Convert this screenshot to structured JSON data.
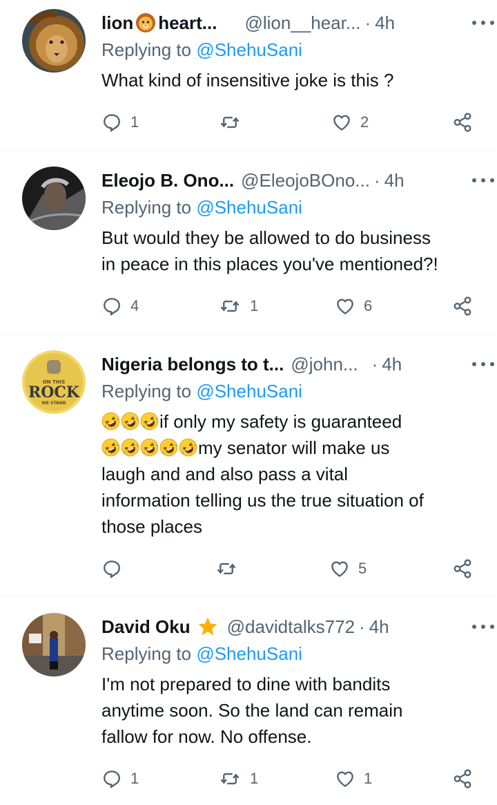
{
  "replying_label": "Replying to",
  "replies": [
    {
      "name": "lion",
      "name_suffix": "heart...",
      "name_emoji": "lion-face",
      "handle": "@lion__hear...",
      "dot": "·",
      "time": "4h",
      "replying_to": "@ShehuSani",
      "lines": [
        "What kind of insensitive joke is this ?"
      ],
      "counts": {
        "reply": "1",
        "retweet": "",
        "like": "2"
      }
    },
    {
      "name": "Eleojo B. Ono...",
      "handle": "@EleojoBOno...",
      "dot": "·",
      "time": "4h",
      "replying_to": "@ShehuSani",
      "lines": [
        "But would they be allowed to do business",
        "in peace in this places you've mentioned?!"
      ],
      "counts": {
        "reply": "4",
        "retweet": "1",
        "like": "6"
      }
    },
    {
      "name": "Nigeria belongs to t...",
      "handle": "@john...",
      "dot": "·",
      "time": "4h",
      "replying_to": "@ShehuSani",
      "avatar_text": {
        "top": "ON THIS",
        "main": "ROCK",
        "bottom": "WE STAND"
      },
      "line1": "if only my safety is guaranteed",
      "line2": "my senator will make us",
      "lines": [
        "laugh and and also pass a vital",
        "information telling us the true situation of",
        "those places"
      ],
      "emoji_name": "rolling-on-floor-laughing",
      "counts": {
        "reply": "",
        "retweet": "",
        "like": "5"
      }
    },
    {
      "name": "David Oku",
      "name_badge": "star",
      "handle": "@davidtalks772",
      "dot": "·",
      "time": "4h",
      "replying_to": "@ShehuSani",
      "lines": [
        "I'm not prepared to dine with bandits",
        "anytime soon. So the land can remain",
        "fallow for now. No offense."
      ],
      "counts": {
        "reply": "1",
        "retweet": "1",
        "like": "1"
      }
    }
  ],
  "icons": {
    "reply": "reply-icon",
    "retweet": "retweet-icon",
    "like": "heart-icon",
    "share": "share-icon",
    "more": "more-icon"
  },
  "colors": {
    "text": "#0f1419",
    "muted": "#536471",
    "link": "#1d9bf0",
    "divider": "#eff3f4",
    "star": "#ffb000"
  }
}
